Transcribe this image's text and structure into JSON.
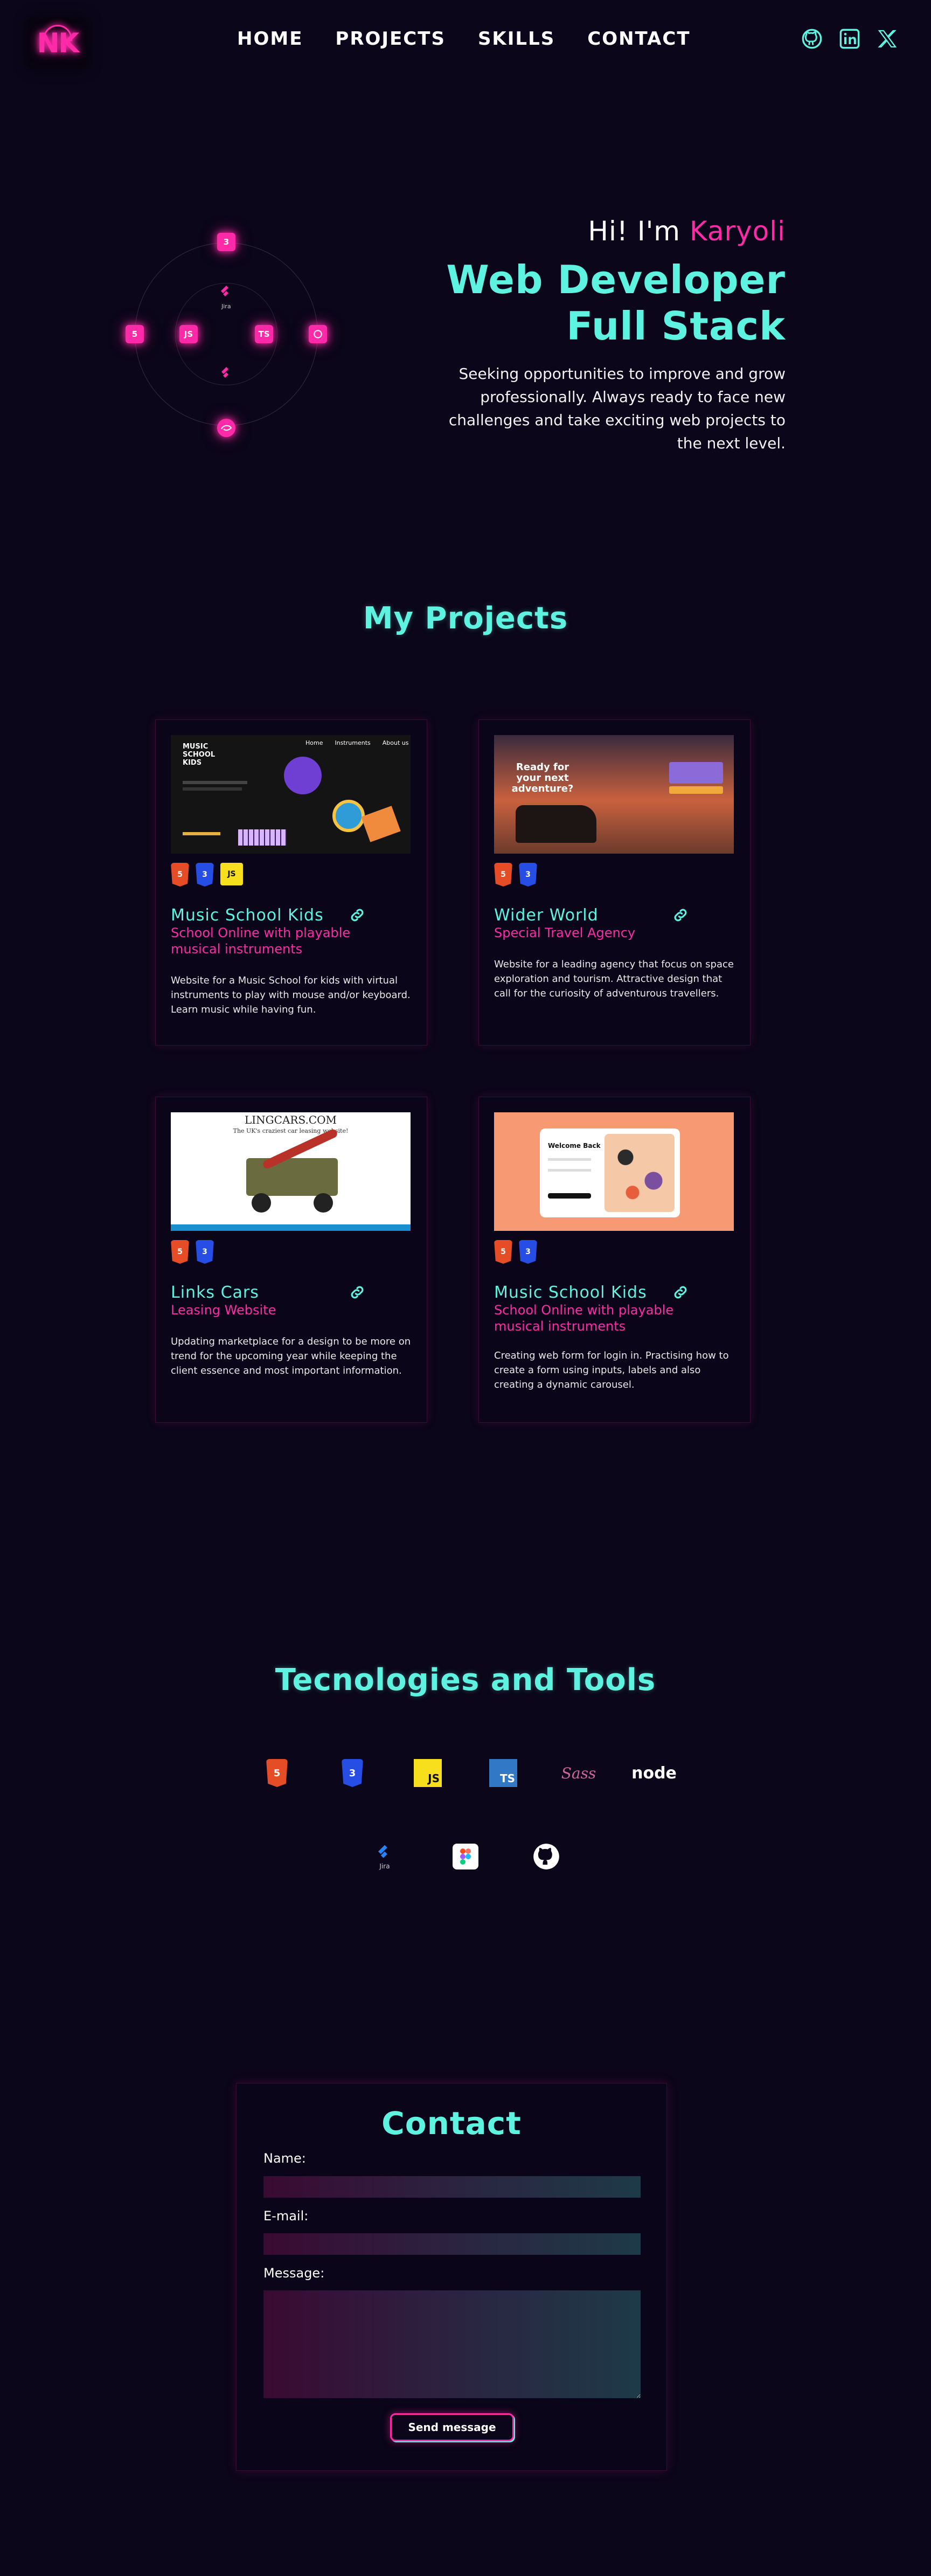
{
  "header": {
    "logo_text": "NK",
    "nav": [
      "HOME",
      "PROJECTS",
      "SKILLS",
      "CONTACT"
    ],
    "socials": [
      "github-icon",
      "linkedin-icon",
      "x-icon"
    ]
  },
  "hero": {
    "greeting": "Hi! I'm ",
    "name": "Karyoli",
    "role_line1": "Web Developer",
    "role_line2": "Full Stack",
    "tagline": "Seeking opportunities to improve and grow professionally. Always ready to face new challenges and take exciting web projects to the next level.",
    "orbit_icons": {
      "css_label": "3",
      "html_label": "5",
      "js_label": "JS",
      "ts_label": "TS",
      "jira_label": "Jira"
    }
  },
  "projects": {
    "title": "My Projects",
    "items": [
      {
        "title": "Music School Kids",
        "subtitle": "School Online with playable musical instruments",
        "description": "Website for a Music School for kids with virtual instruments to play with mouse and/or keyboard. Learn music while having fun.",
        "badges": [
          "html-icon",
          "css-icon",
          "js-icon"
        ],
        "thumb_nav": [
          "Home",
          "Instruments",
          "About us"
        ],
        "thumb_heading": "MUSIC SCHOOL KIDS"
      },
      {
        "title": "Wider World",
        "subtitle": "Special Travel Agency",
        "description": "Website for a leading agency that focus on space exploration and tourism. Attractive design that call for the curiosity of adventurous travellers.",
        "badges": [
          "html-icon",
          "css-icon"
        ],
        "thumb_heading": "Ready for your next adventure?"
      },
      {
        "title": "Links Cars",
        "subtitle": "Leasing Website",
        "description": "Updating marketplace for a design to be more on trend for the upcoming year while keeping the client essence and most important information.",
        "badges": [
          "html-icon",
          "css-icon"
        ],
        "thumb_heading": "LINGCARS.COM",
        "thumb_sub": "The UK's craziest car leasing website!"
      },
      {
        "title": "Music School Kids",
        "subtitle": "School Online with playable musical instruments",
        "description": "Creating web form for login in. Practising how to create a form using inputs, labels and also creating a dynamic carousel.",
        "badges": [
          "html-icon",
          "css-icon"
        ],
        "thumb_heading": "Welcome Back"
      }
    ]
  },
  "tech": {
    "title": "Tecnologies and Tools",
    "row1": [
      "html-icon",
      "css-icon",
      "js-icon",
      "ts-icon",
      "sass-icon",
      "node-icon"
    ],
    "row2": [
      "jira-icon",
      "figma-icon",
      "github-icon"
    ],
    "labels": {
      "js": "JS",
      "ts": "TS",
      "sass": "Sass",
      "node": "node",
      "jira": "Jira"
    }
  },
  "contact": {
    "title": "Contact",
    "name_label": "Name:",
    "email_label": "E-mail:",
    "message_label": "Message:",
    "name_value": "",
    "email_value": "",
    "message_value": "",
    "send_label": "Send message"
  },
  "colors": {
    "background": "#0b0619",
    "accent_cyan": "#5ef2e0",
    "accent_pink": "#ff2aa8"
  }
}
